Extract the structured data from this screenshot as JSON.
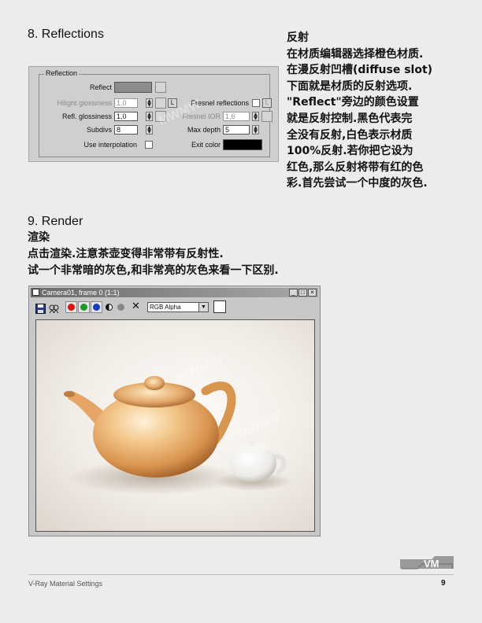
{
  "section8": {
    "title": "8. Reflections"
  },
  "right_text": {
    "lines": [
      "反射",
      "在材质编辑器选择橙色材质.",
      "在漫反射凹槽(diffuse slot)",
      "下面就是材质的反射选项.",
      "\"Reflect\"旁边的颜色设置",
      "就是反射控制.黑色代表完",
      "全没有反射,白色表示材质",
      "100%反射.若你把它设为",
      "红色,那么反射将带有红的色",
      "彩.首先尝试一个中度的灰色."
    ]
  },
  "reflection_panel": {
    "legend": "Reflection",
    "reflect_label": "Reflect",
    "reflect_color": "#8c8c8c",
    "hilight_label": "Hilight glossiness",
    "hilight_value": "1,0",
    "lock_label": "L",
    "fresnel_label": "Fresnel reflections",
    "refl_gloss_label": "Refl. glossiness",
    "refl_gloss_value": "1,0",
    "fresnel_ior_label": "Fresnel IOR",
    "fresnel_ior_value": "1,6",
    "subdivs_label": "Subdivs",
    "subdivs_value": "8",
    "max_depth_label": "Max depth",
    "max_depth_value": "5",
    "use_interp_label": "Use interpolation",
    "exit_color_label": "Exit color",
    "exit_color": "#000000",
    "watermark": "MWMW"
  },
  "section9": {
    "title": "9. Render",
    "lines": [
      "渲染",
      "点击渲染.注意茶壶变得非常带有反射性.",
      "试一个非常暗的灰色,和非常亮的灰色来看一下区别."
    ]
  },
  "render_window": {
    "title": "Camera01, frame 0 (1:1)",
    "min_btn": "_",
    "max_btn": "□",
    "close_btn": "×",
    "channel": "RGB Alpha",
    "clear_icon": "✕",
    "watermark": "MWMW"
  },
  "footer": {
    "left": "V-Ray Material Settings",
    "page": "9",
    "logo_text": "VM"
  }
}
